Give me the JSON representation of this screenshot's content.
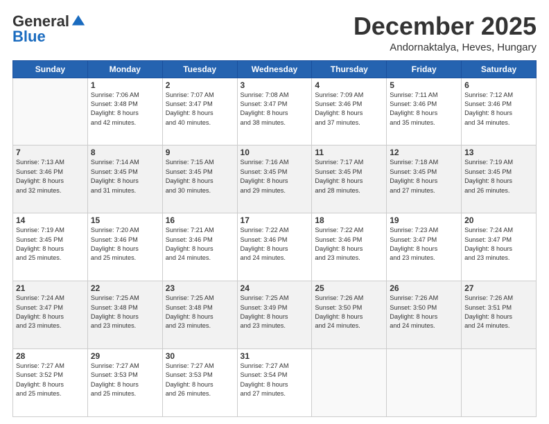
{
  "logo": {
    "general": "General",
    "blue": "Blue"
  },
  "header": {
    "month": "December 2025",
    "location": "Andornaktalya, Heves, Hungary"
  },
  "weekdays": [
    "Sunday",
    "Monday",
    "Tuesday",
    "Wednesday",
    "Thursday",
    "Friday",
    "Saturday"
  ],
  "weeks": [
    [
      {
        "day": "",
        "info": ""
      },
      {
        "day": "1",
        "info": "Sunrise: 7:06 AM\nSunset: 3:48 PM\nDaylight: 8 hours\nand 42 minutes."
      },
      {
        "day": "2",
        "info": "Sunrise: 7:07 AM\nSunset: 3:47 PM\nDaylight: 8 hours\nand 40 minutes."
      },
      {
        "day": "3",
        "info": "Sunrise: 7:08 AM\nSunset: 3:47 PM\nDaylight: 8 hours\nand 38 minutes."
      },
      {
        "day": "4",
        "info": "Sunrise: 7:09 AM\nSunset: 3:46 PM\nDaylight: 8 hours\nand 37 minutes."
      },
      {
        "day": "5",
        "info": "Sunrise: 7:11 AM\nSunset: 3:46 PM\nDaylight: 8 hours\nand 35 minutes."
      },
      {
        "day": "6",
        "info": "Sunrise: 7:12 AM\nSunset: 3:46 PM\nDaylight: 8 hours\nand 34 minutes."
      }
    ],
    [
      {
        "day": "7",
        "info": "Sunrise: 7:13 AM\nSunset: 3:46 PM\nDaylight: 8 hours\nand 32 minutes."
      },
      {
        "day": "8",
        "info": "Sunrise: 7:14 AM\nSunset: 3:45 PM\nDaylight: 8 hours\nand 31 minutes."
      },
      {
        "day": "9",
        "info": "Sunrise: 7:15 AM\nSunset: 3:45 PM\nDaylight: 8 hours\nand 30 minutes."
      },
      {
        "day": "10",
        "info": "Sunrise: 7:16 AM\nSunset: 3:45 PM\nDaylight: 8 hours\nand 29 minutes."
      },
      {
        "day": "11",
        "info": "Sunrise: 7:17 AM\nSunset: 3:45 PM\nDaylight: 8 hours\nand 28 minutes."
      },
      {
        "day": "12",
        "info": "Sunrise: 7:18 AM\nSunset: 3:45 PM\nDaylight: 8 hours\nand 27 minutes."
      },
      {
        "day": "13",
        "info": "Sunrise: 7:19 AM\nSunset: 3:45 PM\nDaylight: 8 hours\nand 26 minutes."
      }
    ],
    [
      {
        "day": "14",
        "info": "Sunrise: 7:19 AM\nSunset: 3:45 PM\nDaylight: 8 hours\nand 25 minutes."
      },
      {
        "day": "15",
        "info": "Sunrise: 7:20 AM\nSunset: 3:46 PM\nDaylight: 8 hours\nand 25 minutes."
      },
      {
        "day": "16",
        "info": "Sunrise: 7:21 AM\nSunset: 3:46 PM\nDaylight: 8 hours\nand 24 minutes."
      },
      {
        "day": "17",
        "info": "Sunrise: 7:22 AM\nSunset: 3:46 PM\nDaylight: 8 hours\nand 24 minutes."
      },
      {
        "day": "18",
        "info": "Sunrise: 7:22 AM\nSunset: 3:46 PM\nDaylight: 8 hours\nand 23 minutes."
      },
      {
        "day": "19",
        "info": "Sunrise: 7:23 AM\nSunset: 3:47 PM\nDaylight: 8 hours\nand 23 minutes."
      },
      {
        "day": "20",
        "info": "Sunrise: 7:24 AM\nSunset: 3:47 PM\nDaylight: 8 hours\nand 23 minutes."
      }
    ],
    [
      {
        "day": "21",
        "info": "Sunrise: 7:24 AM\nSunset: 3:47 PM\nDaylight: 8 hours\nand 23 minutes."
      },
      {
        "day": "22",
        "info": "Sunrise: 7:25 AM\nSunset: 3:48 PM\nDaylight: 8 hours\nand 23 minutes."
      },
      {
        "day": "23",
        "info": "Sunrise: 7:25 AM\nSunset: 3:48 PM\nDaylight: 8 hours\nand 23 minutes."
      },
      {
        "day": "24",
        "info": "Sunrise: 7:25 AM\nSunset: 3:49 PM\nDaylight: 8 hours\nand 23 minutes."
      },
      {
        "day": "25",
        "info": "Sunrise: 7:26 AM\nSunset: 3:50 PM\nDaylight: 8 hours\nand 24 minutes."
      },
      {
        "day": "26",
        "info": "Sunrise: 7:26 AM\nSunset: 3:50 PM\nDaylight: 8 hours\nand 24 minutes."
      },
      {
        "day": "27",
        "info": "Sunrise: 7:26 AM\nSunset: 3:51 PM\nDaylight: 8 hours\nand 24 minutes."
      }
    ],
    [
      {
        "day": "28",
        "info": "Sunrise: 7:27 AM\nSunset: 3:52 PM\nDaylight: 8 hours\nand 25 minutes."
      },
      {
        "day": "29",
        "info": "Sunrise: 7:27 AM\nSunset: 3:53 PM\nDaylight: 8 hours\nand 25 minutes."
      },
      {
        "day": "30",
        "info": "Sunrise: 7:27 AM\nSunset: 3:53 PM\nDaylight: 8 hours\nand 26 minutes."
      },
      {
        "day": "31",
        "info": "Sunrise: 7:27 AM\nSunset: 3:54 PM\nDaylight: 8 hours\nand 27 minutes."
      },
      {
        "day": "",
        "info": ""
      },
      {
        "day": "",
        "info": ""
      },
      {
        "day": "",
        "info": ""
      }
    ]
  ]
}
